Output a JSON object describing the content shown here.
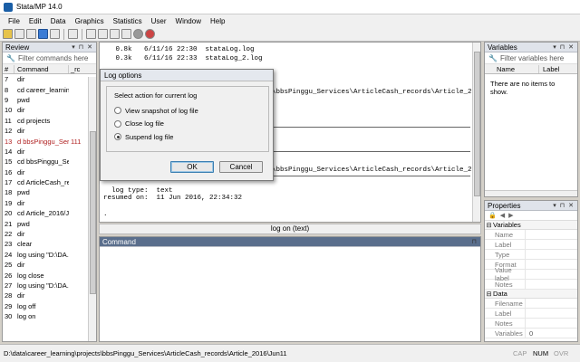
{
  "window": {
    "title": "Stata/MP 14.0"
  },
  "menu": [
    "File",
    "Edit",
    "Data",
    "Graphics",
    "Statistics",
    "User",
    "Window",
    "Help"
  ],
  "review": {
    "title": "Review",
    "filter_placeholder": "Filter commands here",
    "col_num": "#",
    "col_cmd": "Command",
    "col_rc": "_rc",
    "rows": [
      {
        "n": "7",
        "cmd": "dir",
        "rc": ""
      },
      {
        "n": "8",
        "cmd": "cd career_learning",
        "rc": ""
      },
      {
        "n": "9",
        "cmd": "pwd",
        "rc": ""
      },
      {
        "n": "10",
        "cmd": "dir",
        "rc": ""
      },
      {
        "n": "11",
        "cmd": "cd projects",
        "rc": ""
      },
      {
        "n": "12",
        "cmd": "dir",
        "rc": ""
      },
      {
        "n": "13",
        "cmd": "d bbsPinggu_Ser...",
        "rc": "111",
        "error": true
      },
      {
        "n": "14",
        "cmd": "dir",
        "rc": ""
      },
      {
        "n": "15",
        "cmd": "cd bbsPinggu_Se...",
        "rc": ""
      },
      {
        "n": "16",
        "cmd": "dir",
        "rc": ""
      },
      {
        "n": "17",
        "cmd": "cd ArticleCash_re...",
        "rc": ""
      },
      {
        "n": "18",
        "cmd": "pwd",
        "rc": ""
      },
      {
        "n": "19",
        "cmd": "dir",
        "rc": ""
      },
      {
        "n": "20",
        "cmd": "cd Article_2016/Ju...",
        "rc": ""
      },
      {
        "n": "21",
        "cmd": "pwd",
        "rc": ""
      },
      {
        "n": "22",
        "cmd": "dir",
        "rc": ""
      },
      {
        "n": "23",
        "cmd": "clear",
        "rc": ""
      },
      {
        "n": "24",
        "cmd": "log using \"D:\\DA...",
        "rc": ""
      },
      {
        "n": "25",
        "cmd": "dir",
        "rc": ""
      },
      {
        "n": "26",
        "cmd": "log close",
        "rc": ""
      },
      {
        "n": "27",
        "cmd": "log using \"D:\\DA...",
        "rc": ""
      },
      {
        "n": "28",
        "cmd": "dir",
        "rc": ""
      },
      {
        "n": "29",
        "cmd": "log off",
        "rc": ""
      },
      {
        "n": "30",
        "cmd": "log on",
        "rc": ""
      }
    ]
  },
  "results": {
    "line1": "   0.8k   6/11/16 22:30  stataLog.log",
    "line2": "   0.3k   6/11/16 22:33  stataLog_2.log",
    "path1": "\\bbsPinggu_Services\\ArticleCash_records\\Article_201",
    "path2": "\\bbsPinggu_Services\\ArticleCash_records\\Article_201",
    "log_type": "  log type:  text",
    "resumed": "resumed on:  11 Jun 2016, 22:34:32",
    "prompt": "."
  },
  "results_status": "log on (text)",
  "command": {
    "title": "Command"
  },
  "variables": {
    "title": "Variables",
    "filter_placeholder": "Filter variables here",
    "col_name": "Name",
    "col_label": "Label",
    "empty": "There are no items to show."
  },
  "properties": {
    "title": "Properties",
    "variables_section": "Variables",
    "var_fields": [
      "Name",
      "Label",
      "Type",
      "Format",
      "Value label",
      "Notes"
    ],
    "data_section": "Data",
    "data_fields": [
      {
        "k": "Filename",
        "v": ""
      },
      {
        "k": "Label",
        "v": ""
      },
      {
        "k": "Notes",
        "v": ""
      },
      {
        "k": "Variables",
        "v": "0"
      }
    ]
  },
  "statusbar": {
    "path": "D:\\data\\career_learning\\projects\\bbsPinggu_Services\\ArticleCash_records\\Article_2016\\Jun11",
    "cap": "CAP",
    "num": "NUM",
    "ovr": "OVR"
  },
  "dialog": {
    "title": "Log options",
    "group_label": "Select action for current log",
    "options": [
      "View snapshot of log file",
      "Close log file",
      "Suspend log file"
    ],
    "selected": 2,
    "ok": "OK",
    "cancel": "Cancel"
  }
}
